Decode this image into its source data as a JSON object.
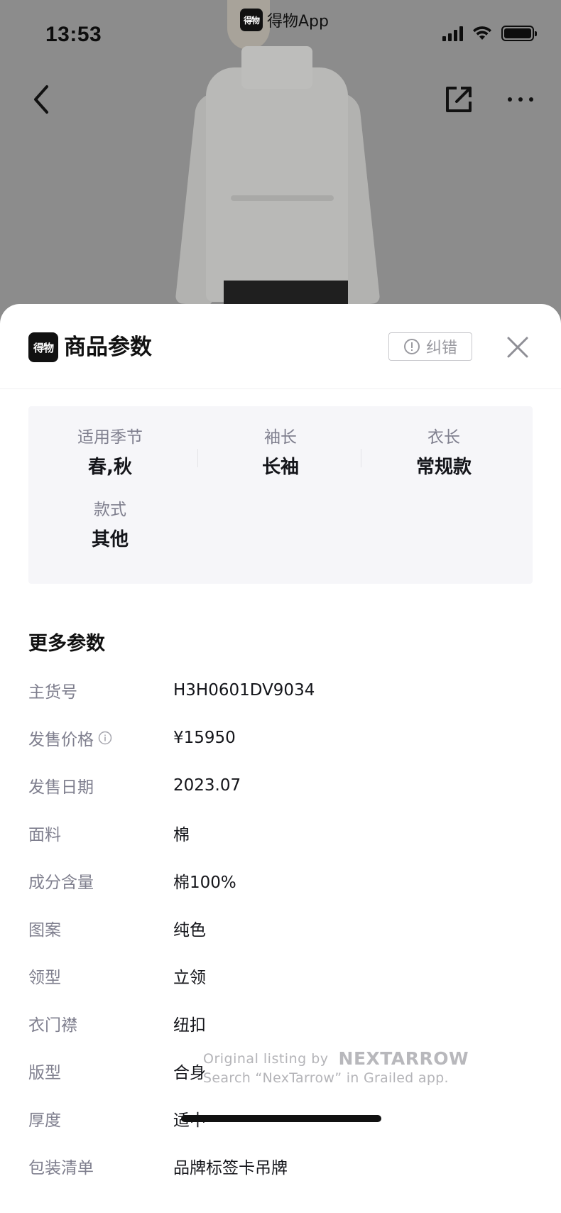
{
  "status_bar": {
    "time": "13:53",
    "app_name": "得物App",
    "app_logo_text": "得物",
    "icons": [
      "signal-icon",
      "wifi-icon",
      "battery-icon"
    ]
  },
  "top_nav": {
    "icons": [
      "back-icon",
      "share-icon",
      "more-icon"
    ]
  },
  "sheet": {
    "logo_text": "得物",
    "title": "商品参数",
    "report_label": "纠错",
    "key_attributes": [
      {
        "label": "适用季节",
        "value": "春,秋"
      },
      {
        "label": "袖长",
        "value": "长袖"
      },
      {
        "label": "衣长",
        "value": "常规款"
      },
      {
        "label": "款式",
        "value": "其他"
      }
    ],
    "more_title": "更多参数",
    "params": [
      {
        "label": "主货号",
        "value": "H3H0601DV9034"
      },
      {
        "label": "发售价格",
        "value": "¥15950",
        "has_info": true
      },
      {
        "label": "发售日期",
        "value": "2023.07"
      },
      {
        "label": "面料",
        "value": "棉"
      },
      {
        "label": "成分含量",
        "value": "棉100%"
      },
      {
        "label": "图案",
        "value": "纯色"
      },
      {
        "label": "领型",
        "value": "立领"
      },
      {
        "label": "衣门襟",
        "value": "纽扣"
      },
      {
        "label": "版型",
        "value": "合身"
      },
      {
        "label": "厚度",
        "value": "适中"
      },
      {
        "label": "包装清单",
        "value": "品牌标签卡吊牌"
      }
    ]
  },
  "watermark": {
    "line1": "Original listing by",
    "brand": "NEXTARROW",
    "line2": "Search “NexTarrow” in Grailed app."
  },
  "colors": {
    "backdrop": "#8c8c8c",
    "label_gray": "#7f7f8e",
    "card_bg": "#f6f6f9",
    "text_dark": "#14151a"
  }
}
